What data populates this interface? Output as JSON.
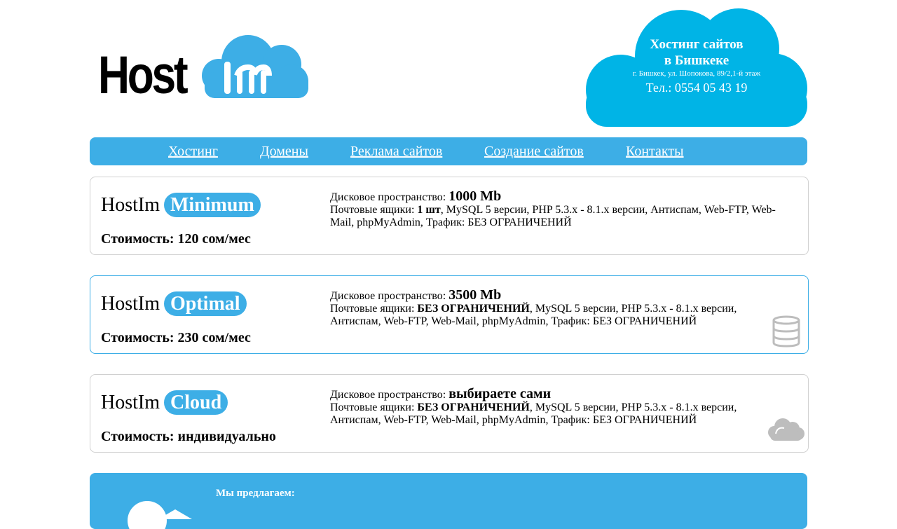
{
  "header": {
    "logo": {
      "text": "Host"
    },
    "contact": {
      "title_line1": "Хостинг сайтов",
      "title_line2": "в Бишкеке",
      "address": "г. Бишкек, ул. Шопокова, 89/2,1-й этаж",
      "phone": "Тел.: 0554 05 43 19"
    }
  },
  "nav": {
    "items": [
      {
        "label": "Хостинг"
      },
      {
        "label": "Домены"
      },
      {
        "label": "Реклама сайтов"
      },
      {
        "label": "Создание сайтов"
      },
      {
        "label": "Контакты"
      }
    ]
  },
  "plans": [
    {
      "brand": "HostIm",
      "tier": "Minimum",
      "price": "Стоимость: 120 сом/мес",
      "disk_label": "Дисковое пространство:",
      "disk_value": "1000 Mb",
      "mail_label": "Почтовые ящики:",
      "mail_value": "1 шт",
      "features": ", MySQL 5 версии, PHP 5.3.x - 8.1.x версии, Антиспам, Web-FTP, Web-Mail, phpMyAdmin, Трафик: БЕЗ ОГРАНИЧЕНИЙ"
    },
    {
      "brand": "HostIm",
      "tier": "Optimal",
      "price": "Стоимость: 230 сом/мес",
      "disk_label": "Дисковое пространство:",
      "disk_value": "3500 Mb",
      "mail_label": "Почтовые ящики:",
      "mail_value": "БЕЗ ОГРАНИЧЕНИЙ",
      "features": ", MySQL 5 версии, PHP 5.3.x - 8.1.x версии, Антиспам, Web-FTP, Web-Mail, phpMyAdmin, Трафик: БЕЗ ОГРАНИЧЕНИЙ",
      "icon": "database-icon"
    },
    {
      "brand": "HostIm",
      "tier": "Cloud",
      "price": "Стоимость: индивидуально",
      "disk_label": "Дисковое пространство:",
      "disk_value": "выбираете сами",
      "mail_label": "Почтовые ящики:",
      "mail_value": "БЕЗ ОГРАНИЧЕНИЙ",
      "features": ", MySQL 5 версии, PHP 5.3.x - 8.1.x версии, Антиспам, Web-FTP, Web-Mail, phpMyAdmin, Трафик: БЕЗ ОГРАНИЧЕНИЙ",
      "icon": "cloud-icon"
    }
  ],
  "offer": {
    "title": "Мы предлагаем:"
  },
  "colors": {
    "accent": "#3daee6",
    "contact_cloud": "#00b4e6",
    "icon_gray": "#bdbdbd"
  }
}
